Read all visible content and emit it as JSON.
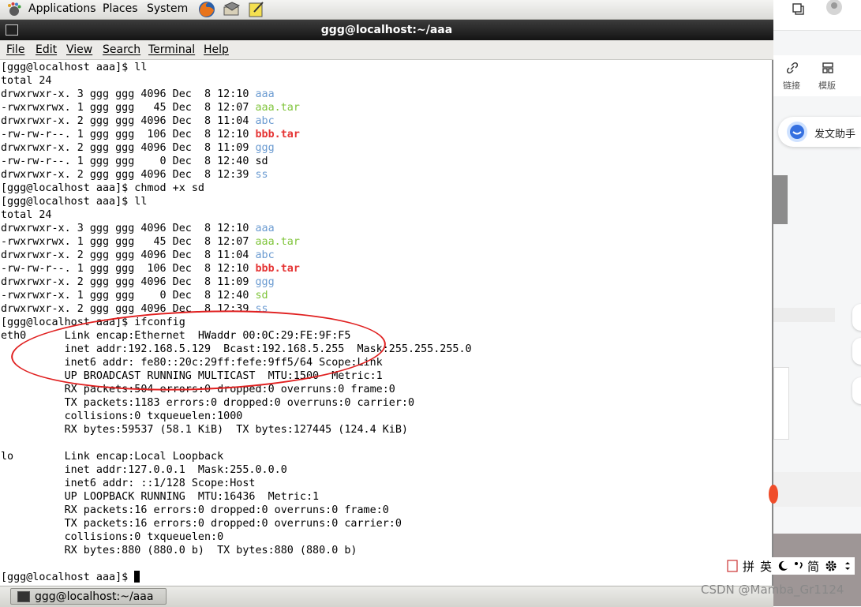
{
  "top_panel": {
    "menus": [
      "Applications",
      "Places",
      "System"
    ]
  },
  "window": {
    "title": "ggg@localhost:~/aaa",
    "menu": [
      "File",
      "Edit",
      "View",
      "Search",
      "Terminal",
      "Help"
    ]
  },
  "terminal": {
    "lines": [
      [
        {
          "t": "[ggg@localhost aaa]$ ll"
        }
      ],
      [
        {
          "t": "total 24"
        }
      ],
      [
        {
          "t": "drwxrwxr-x. 3 ggg ggg 4096 Dec  8 12:10 "
        },
        {
          "t": "aaa",
          "c": "dir"
        }
      ],
      [
        {
          "t": "-rwxrwxrwx. 1 ggg ggg   45 Dec  8 12:07 "
        },
        {
          "t": "aaa.tar",
          "c": "tar"
        }
      ],
      [
        {
          "t": "drwxrwxr-x. 2 ggg ggg 4096 Dec  8 11:04 "
        },
        {
          "t": "abc",
          "c": "dir"
        }
      ],
      [
        {
          "t": "-rw-rw-r--. 1 ggg ggg  106 Dec  8 12:10 "
        },
        {
          "t": "bbb.tar",
          "c": "red"
        }
      ],
      [
        {
          "t": "drwxrwxr-x. 2 ggg ggg 4096 Dec  8 11:09 "
        },
        {
          "t": "ggg",
          "c": "dir"
        }
      ],
      [
        {
          "t": "-rw-rw-r--. 1 ggg ggg    0 Dec  8 12:40 sd"
        }
      ],
      [
        {
          "t": "drwxrwxr-x. 2 ggg ggg 4096 Dec  8 12:39 "
        },
        {
          "t": "ss",
          "c": "dir"
        }
      ],
      [
        {
          "t": "[ggg@localhost aaa]$ chmod +x sd"
        }
      ],
      [
        {
          "t": "[ggg@localhost aaa]$ ll"
        }
      ],
      [
        {
          "t": "total 24"
        }
      ],
      [
        {
          "t": "drwxrwxr-x. 3 ggg ggg 4096 Dec  8 12:10 "
        },
        {
          "t": "aaa",
          "c": "dir"
        }
      ],
      [
        {
          "t": "-rwxrwxrwx. 1 ggg ggg   45 Dec  8 12:07 "
        },
        {
          "t": "aaa.tar",
          "c": "tar"
        }
      ],
      [
        {
          "t": "drwxrwxr-x. 2 ggg ggg 4096 Dec  8 11:04 "
        },
        {
          "t": "abc",
          "c": "dir"
        }
      ],
      [
        {
          "t": "-rw-rw-r--. 1 ggg ggg  106 Dec  8 12:10 "
        },
        {
          "t": "bbb.tar",
          "c": "red"
        }
      ],
      [
        {
          "t": "drwxrwxr-x. 2 ggg ggg 4096 Dec  8 11:09 "
        },
        {
          "t": "ggg",
          "c": "dir"
        }
      ],
      [
        {
          "t": "-rwxrwxr-x. 1 ggg ggg    0 Dec  8 12:40 "
        },
        {
          "t": "sd",
          "c": "exe"
        }
      ],
      [
        {
          "t": "drwxrwxr-x. 2 ggg ggg 4096 Dec  8 12:39 "
        },
        {
          "t": "ss",
          "c": "dir"
        }
      ],
      [
        {
          "t": "[ggg@localhost aaa]$ ifconfig"
        }
      ],
      [
        {
          "t": "eth0      Link encap:Ethernet  HWaddr 00:0C:29:FE:9F:F5"
        }
      ],
      [
        {
          "t": "          inet addr:192.168.5.129  Bcast:192.168.5.255  Mask:255.255.255.0"
        }
      ],
      [
        {
          "t": "          inet6 addr: fe80::20c:29ff:fefe:9ff5/64 Scope:Link"
        }
      ],
      [
        {
          "t": "          UP BROADCAST RUNNING MULTICAST  MTU:1500  Metric:1"
        }
      ],
      [
        {
          "t": "          RX packets:504 errors:0 dropped:0 overruns:0 frame:0"
        }
      ],
      [
        {
          "t": "          TX packets:1183 errors:0 dropped:0 overruns:0 carrier:0"
        }
      ],
      [
        {
          "t": "          collisions:0 txqueuelen:1000"
        }
      ],
      [
        {
          "t": "          RX bytes:59537 (58.1 KiB)  TX bytes:127445 (124.4 KiB)"
        }
      ],
      [
        {
          "t": ""
        }
      ],
      [
        {
          "t": "lo        Link encap:Local Loopback"
        }
      ],
      [
        {
          "t": "          inet addr:127.0.0.1  Mask:255.0.0.0"
        }
      ],
      [
        {
          "t": "          inet6 addr: ::1/128 Scope:Host"
        }
      ],
      [
        {
          "t": "          UP LOOPBACK RUNNING  MTU:16436  Metric:1"
        }
      ],
      [
        {
          "t": "          RX packets:16 errors:0 dropped:0 overruns:0 frame:0"
        }
      ],
      [
        {
          "t": "          TX packets:16 errors:0 dropped:0 overruns:0 carrier:0"
        }
      ],
      [
        {
          "t": "          collisions:0 txqueuelen:0"
        }
      ],
      [
        {
          "t": "          RX bytes:880 (880.0 b)  TX bytes:880 (880.0 b)"
        }
      ],
      [
        {
          "t": ""
        }
      ],
      [
        {
          "t": "[ggg@localhost aaa]$ "
        }
      ]
    ]
  },
  "taskbar": {
    "item_label": "ggg@localhost:~/aaa"
  },
  "right_strip": {
    "link_label": "链接",
    "template_label": "模版",
    "assistant_label": "发文助手"
  },
  "ime": {
    "chars": [
      "拼",
      "英",
      "简"
    ]
  },
  "watermark": "CSDN @Mamba_Gr1124",
  "colors": {
    "directory": "#6b9bd1",
    "archive": "#7fc43a",
    "red_file": "#e53535",
    "highlight_ellipse": "#e02020"
  }
}
